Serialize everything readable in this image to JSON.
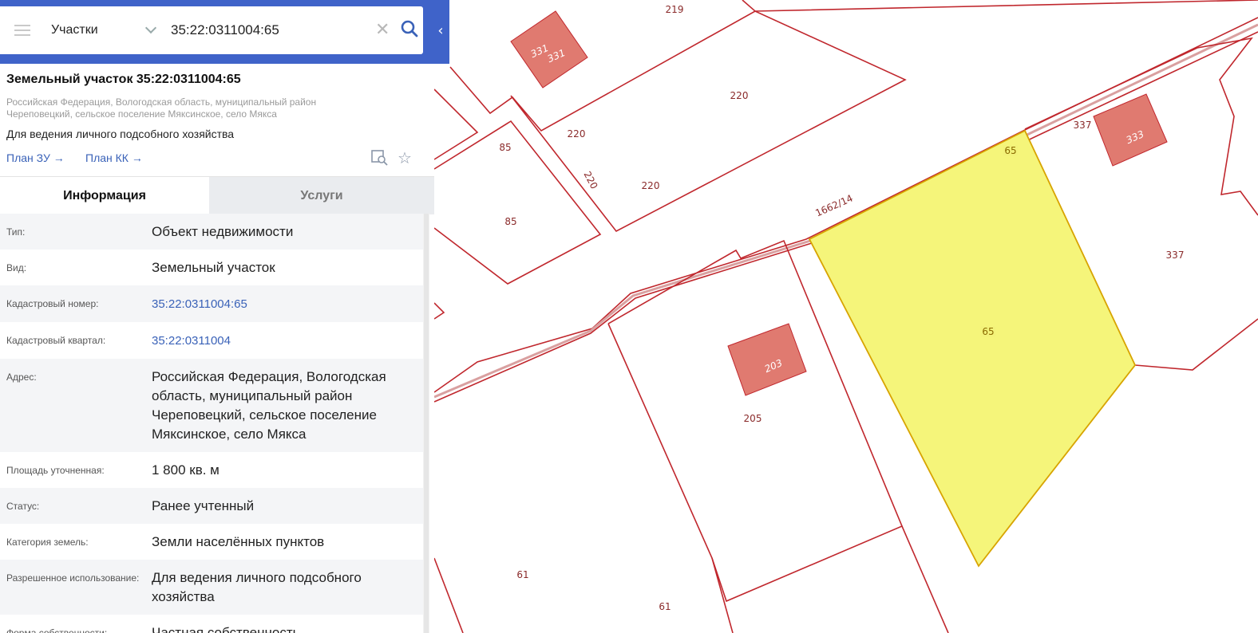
{
  "search": {
    "layer_label": "Участки",
    "query": "35:22:0311004:65"
  },
  "panel": {
    "title": "Земельный участок 35:22:0311004:65",
    "address_short": "Российская Федерация, Вологодская область, муниципальный район Череповецкий, сельское поселение Мяксинское, село Мякса",
    "permitted_use_summary": "Для ведения личного подсобного хозяйства",
    "plan_zu_label": "План ЗУ",
    "plan_kk_label": "План КК",
    "tabs": [
      {
        "label": "Информация",
        "active": true
      },
      {
        "label": "Услуги",
        "active": false
      }
    ],
    "rows": [
      {
        "label": "Тип:",
        "value": "Объект недвижимости",
        "link": false
      },
      {
        "label": "Вид:",
        "value": "Земельный участок",
        "link": false
      },
      {
        "label": "Кадастровый номер:",
        "value": "35:22:0311004:65",
        "link": true
      },
      {
        "label": "Кадастровый квартал:",
        "value": "35:22:0311004",
        "link": true
      },
      {
        "label": "Адрес:",
        "value": "Российская Федерация, Вологодская область, муниципальный район Череповецкий, сельское поселение Мяксинское, село Мякса",
        "link": false
      },
      {
        "label": "Площадь уточненная:",
        "value": "1 800 кв. м",
        "link": false
      },
      {
        "label": "Статус:",
        "value": "Ранее учтенный",
        "link": false
      },
      {
        "label": "Категория земель:",
        "value": "Земли населённых пунктов",
        "link": false
      },
      {
        "label": "Разрешенное использование:",
        "value": "Для ведения личного подсобного хозяйства",
        "link": false
      },
      {
        "label": "Форма собственности:",
        "value": "Частная собственность",
        "link": false
      }
    ]
  },
  "map": {
    "colors": {
      "boundary": "#c0272d",
      "building": "#e07a70",
      "selected": "#f5f57a",
      "road": "#d9a0a0"
    },
    "labels": {
      "l219": "219",
      "l331a": "331",
      "l331b": "331",
      "l220a": "220",
      "l220b": "220",
      "l220c": "220",
      "l220d": "220",
      "l85a": "85",
      "l85b": "85",
      "l1662": "1662/14",
      "l65a": "65",
      "l65b": "65",
      "l337a": "337",
      "l333": "333",
      "l337b": "337",
      "l203": "203",
      "l205": "205",
      "l61a": "61",
      "l61b": "61"
    }
  }
}
